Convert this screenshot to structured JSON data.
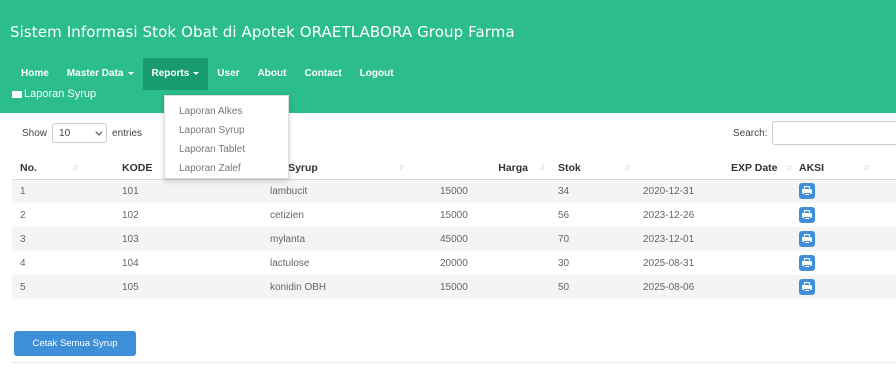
{
  "app": {
    "title": "Sistem Informasi Stok Obat di Apotek ORAETLABORA Group Farma"
  },
  "nav": {
    "items": [
      {
        "label": "Home",
        "has_dropdown": false
      },
      {
        "label": "Master Data",
        "has_dropdown": true
      },
      {
        "label": "Reports",
        "has_dropdown": true,
        "active": true
      },
      {
        "label": "User",
        "has_dropdown": false
      },
      {
        "label": "About",
        "has_dropdown": false
      },
      {
        "label": "Contact",
        "has_dropdown": false
      },
      {
        "label": "Logout",
        "has_dropdown": false
      }
    ]
  },
  "reports_menu": {
    "items": [
      "Laporan Alkes",
      "Laporan Syrup",
      "Laporan Tablet",
      "Laporan Zalef"
    ]
  },
  "panel": {
    "heading": "Laporan Syrup",
    "icon": "car-icon"
  },
  "table_controls": {
    "show_label": "Show",
    "page_length": "10",
    "entries_label": "entries",
    "search_label": "Search:",
    "search_value": ""
  },
  "table": {
    "headers": [
      "No.",
      "KODE",
      "Nama Syrup",
      "Harga",
      "Stok",
      "EXP Date",
      "AKSI"
    ],
    "header_visible": [
      "No.",
      "KODE",
      "ma Syrup",
      "Harga",
      "Stok",
      "EXP Date",
      "AKSI"
    ],
    "rows": [
      {
        "no": "1",
        "kode": "101",
        "nama": "lambucit",
        "harga": "15000",
        "stok": "34",
        "exp": "2020-12-31"
      },
      {
        "no": "2",
        "kode": "102",
        "nama": "cetizien",
        "harga": "15000",
        "stok": "56",
        "exp": "2023-12-26"
      },
      {
        "no": "3",
        "kode": "103",
        "nama": "mylanta",
        "harga": "45000",
        "stok": "70",
        "exp": "2023-12-01"
      },
      {
        "no": "4",
        "kode": "104",
        "nama": "lactulose",
        "harga": "20000",
        "stok": "30",
        "exp": "2025-08-31"
      },
      {
        "no": "5",
        "kode": "105",
        "nama": "konidin OBH",
        "harga": "15000",
        "stok": "50",
        "exp": "2025-08-06"
      }
    ],
    "row_action_icon": "print-icon"
  },
  "print_all_button": {
    "label": "Cetak Semua Syrup"
  },
  "colors": {
    "header_bg": "#2bbd8c",
    "nav_active_bg": "#199b72",
    "button_blue": "#3f8ed8"
  }
}
